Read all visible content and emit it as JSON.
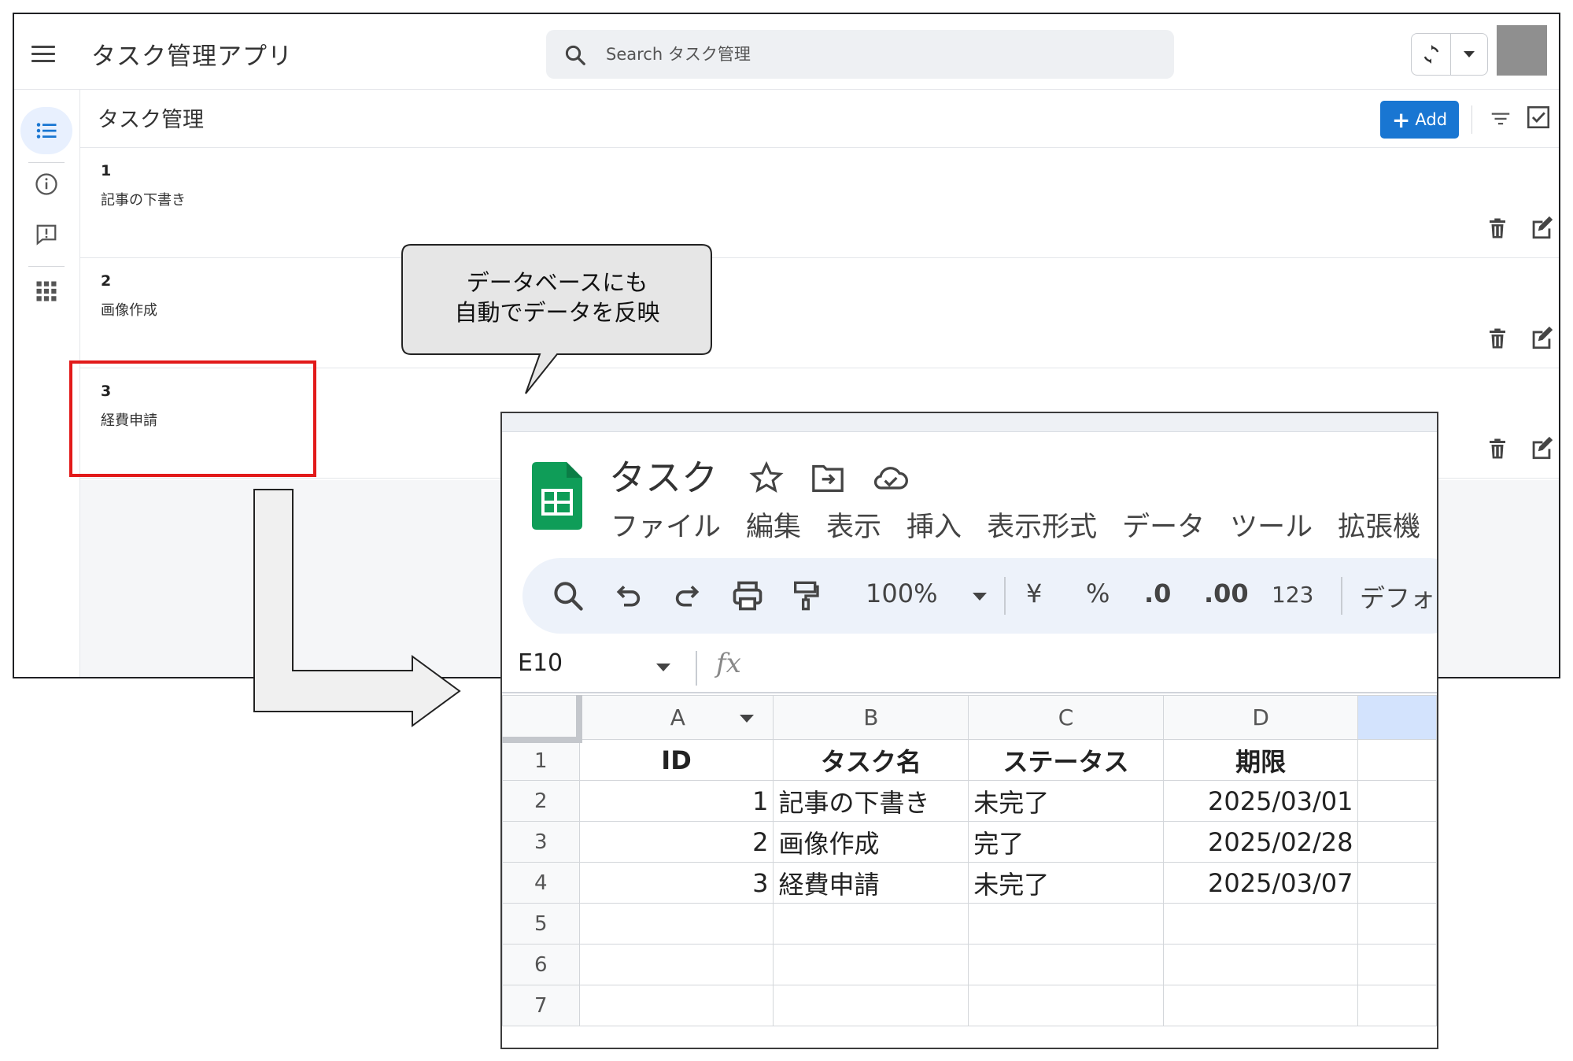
{
  "app": {
    "title": "タスク管理アプリ",
    "search_placeholder": "Search タスク管理",
    "page_title": "タスク管理",
    "add_label": "Add",
    "tasks": [
      {
        "id": "1",
        "name": "記事の下書き"
      },
      {
        "id": "2",
        "name": "画像作成"
      },
      {
        "id": "3",
        "name": "経費申請"
      }
    ]
  },
  "callout": {
    "line1": "データベースにも",
    "line2": "自動でデータを反映"
  },
  "sheet": {
    "doc_title": "タスク",
    "menu": [
      "ファイル",
      "編集",
      "表示",
      "挿入",
      "表示形式",
      "データ",
      "ツール",
      "拡張機"
    ],
    "toolbar": {
      "zoom": "100%",
      "currency": "¥",
      "percent": "%",
      "dec_decrease": ".0",
      "dec_increase": ".00",
      "number_format": "123",
      "font": "デフォ."
    },
    "name_box": "E10",
    "fx": "fx",
    "columns": [
      "A",
      "B",
      "C",
      "D"
    ],
    "row_numbers": [
      "1",
      "2",
      "3",
      "4",
      "5",
      "6",
      "7"
    ],
    "header_row": [
      "ID",
      "タスク名",
      "ステータス",
      "期限"
    ],
    "rows": [
      [
        "1",
        "記事の下書き",
        "未完了",
        "2025/03/01"
      ],
      [
        "2",
        "画像作成",
        "完了",
        "2025/02/28"
      ],
      [
        "3",
        "経費申請",
        "未完了",
        "2025/03/07"
      ]
    ]
  },
  "colors": {
    "accent": "#1976d2",
    "highlight_red": "#e21a1a",
    "sheets_green": "#0f9d58",
    "selected_col": "#d3e3fd"
  }
}
